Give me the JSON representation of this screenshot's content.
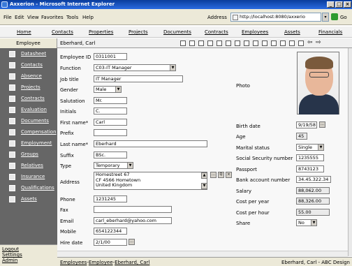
{
  "window": {
    "title": "Axxerion - Microsoft Internet Explorer"
  },
  "menu": [
    "File",
    "Edit",
    "View",
    "Favorites",
    "Tools",
    "Help"
  ],
  "address": {
    "label": "Address",
    "url": "http://localhost:8080/axxerio",
    "go": "Go"
  },
  "nav_tabs": [
    "Home",
    "Contacts",
    "Properties",
    "Projects",
    "Documents",
    "Contracts",
    "Employees",
    "Assets",
    "Financials"
  ],
  "header": {
    "section": "Employee",
    "record_title": "Eberhard, Carl"
  },
  "sidebar": {
    "items": [
      "Datasheet",
      "Contacts",
      "Absence",
      "Projects",
      "Contracts",
      "Evaluation",
      "Documents",
      "Compensation",
      "Employment",
      "Groups",
      "Relatives",
      "Insurance",
      "Qualifications",
      "Assets"
    ],
    "footer": [
      "Logout",
      "Settings",
      "Admin"
    ]
  },
  "form": {
    "employee_id": {
      "label": "Employee ID",
      "value": "0311001"
    },
    "function": {
      "label": "Function",
      "value": "C03-IT Manager"
    },
    "job_title": {
      "label": "Job title",
      "value": "IT Manager"
    },
    "gender": {
      "label": "Gender",
      "value": "Male"
    },
    "salutation": {
      "label": "Salutation",
      "value": "Mr."
    },
    "initials": {
      "label": "Initials",
      "value": "C."
    },
    "first_name": {
      "label": "First name*",
      "value": "Carl"
    },
    "prefix": {
      "label": "Prefix",
      "value": ""
    },
    "last_name": {
      "label": "Last name*",
      "value": "Eberhard"
    },
    "suffix": {
      "label": "Suffix",
      "value": "BSc."
    },
    "type": {
      "label": "Type",
      "value": "Temporary"
    },
    "address": {
      "label": "Address",
      "value": "Homestreet 67\nCF 4566 Hometown\nUnited Kingdom"
    },
    "phone": {
      "label": "Phone",
      "value": "1231245"
    },
    "fax": {
      "label": "Fax",
      "value": ""
    },
    "email": {
      "label": "Email",
      "value": "carl_eberhard@yahoo.com"
    },
    "mobile": {
      "label": "Mobile",
      "value": "654122344"
    },
    "hire_date": {
      "label": "Hire date",
      "value": "2/1/00"
    },
    "photo": {
      "label": "Photo"
    },
    "birth_date": {
      "label": "Birth date",
      "value": "9/19/58"
    },
    "age": {
      "label": "Age",
      "value": "45"
    },
    "marital_status": {
      "label": "Marital status",
      "value": "Single"
    },
    "ssn": {
      "label": "Social Security number",
      "value": "1235555"
    },
    "passport": {
      "label": "Passport",
      "value": "8743123"
    },
    "bank_account": {
      "label": "Bank account number",
      "value": "34.45.322.34"
    },
    "salary": {
      "label": "Salary",
      "value": "88,062.00"
    },
    "cost_per_year": {
      "label": "Cost per year",
      "value": "88,326.00"
    },
    "cost_per_hour": {
      "label": "Cost per hour",
      "value": "55.00"
    },
    "share": {
      "label": "Share",
      "value": "No"
    }
  },
  "status": {
    "breadcrumb": [
      "Employees",
      "Employee",
      "Eberhard, Carl"
    ],
    "right": "Eberhard, Carl - ABC Design"
  }
}
